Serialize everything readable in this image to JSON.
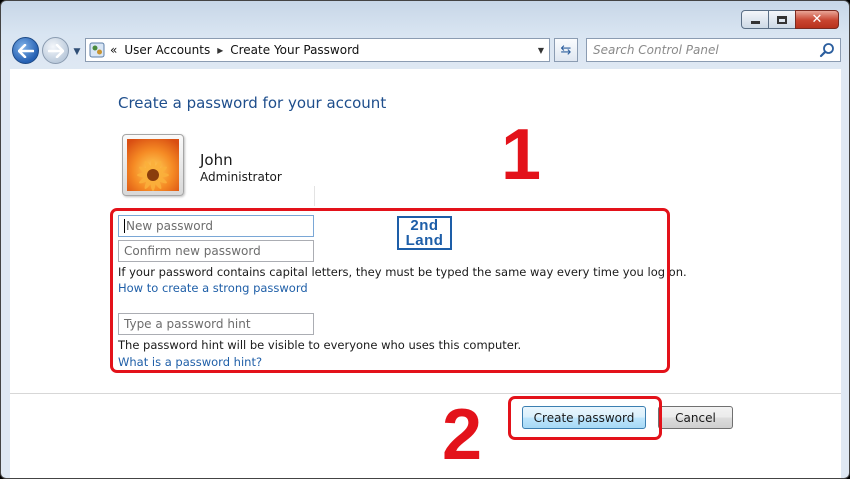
{
  "breadcrumb": {
    "prefix": "«",
    "items": [
      "User Accounts",
      "Create Your Password"
    ],
    "separator": "▸"
  },
  "search": {
    "placeholder": "Search Control Panel"
  },
  "page": {
    "title": "Create a password for your account"
  },
  "user": {
    "name": "John",
    "role": "Administrator"
  },
  "form": {
    "new_password_placeholder": "New password",
    "confirm_password_placeholder": "Confirm new password",
    "caps_info": "If your password contains capital letters, they must be typed the same way every time you log on.",
    "strong_password_link": "How to create a strong password",
    "hint_placeholder": "Type a password hint",
    "hint_info": "The password hint will be visible to everyone who uses this computer.",
    "hint_link": "What is a password hint?"
  },
  "buttons": {
    "create": "Create password",
    "cancel": "Cancel"
  },
  "watermark": {
    "line1": "2nd",
    "line2": "Land"
  },
  "annotations": {
    "step1": "1",
    "step2": "2"
  },
  "colors": {
    "highlight": "#e3121a",
    "link": "#1f5fa8",
    "title": "#1e4e8c",
    "brand": "#1d5ea8"
  },
  "icons": [
    "back-arrow-icon",
    "forward-arrow-icon",
    "control-panel-icon",
    "refresh-icon",
    "magnifier-icon",
    "minimize-icon",
    "maximize-icon",
    "close-icon"
  ]
}
